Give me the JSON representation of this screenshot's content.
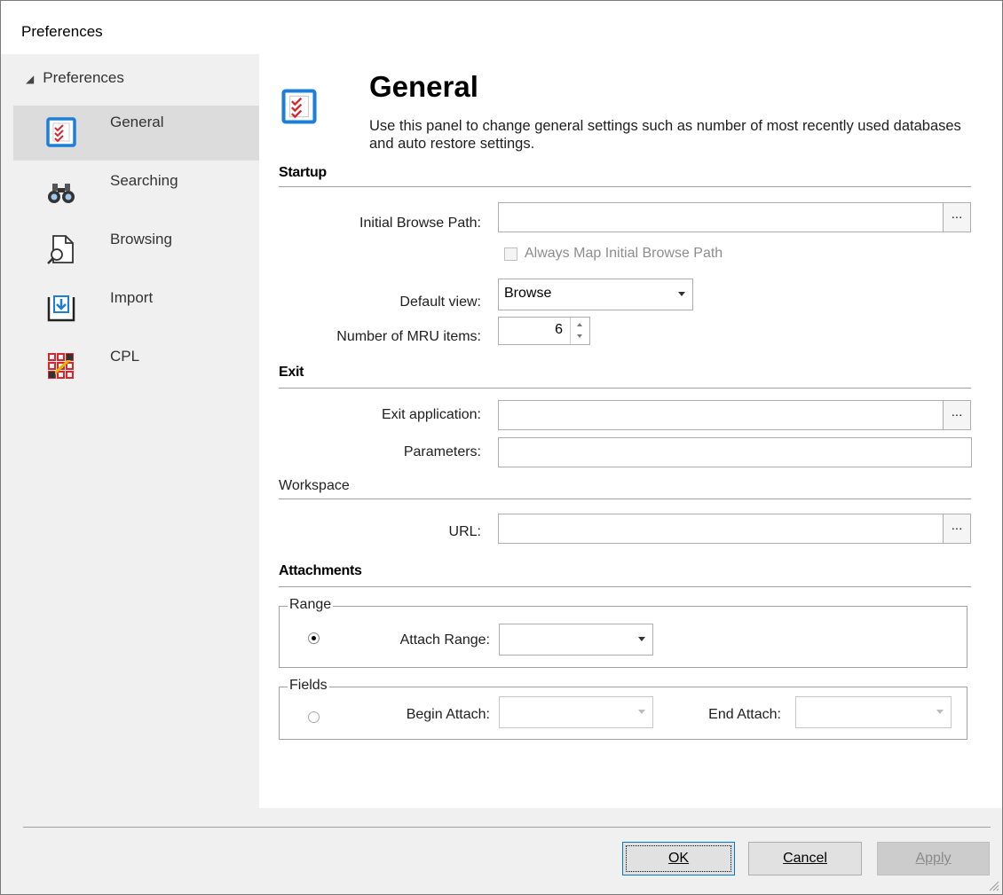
{
  "window": {
    "title": "Preferences"
  },
  "nav": {
    "root_label": "Preferences",
    "items": [
      {
        "label": "General",
        "icon": "checklist-icon",
        "selected": true
      },
      {
        "label": "Searching",
        "icon": "binoculars-icon",
        "selected": false
      },
      {
        "label": "Browsing",
        "icon": "document-search-icon",
        "selected": false
      },
      {
        "label": "Import",
        "icon": "import-tray-icon",
        "selected": false
      },
      {
        "label": "CPL",
        "icon": "grid-pencil-icon",
        "selected": false
      }
    ]
  },
  "page": {
    "title": "General",
    "description": "Use this panel to change general settings such as number of most recently used databases and auto restore settings."
  },
  "startup": {
    "heading": "Startup",
    "initial_browse_path_label": "Initial Browse Path:",
    "initial_browse_path_value": "",
    "browse_button": "...",
    "always_map_label": "Always Map Initial Browse Path",
    "always_map_checked": false,
    "default_view_label": "Default view:",
    "default_view_value": "Browse",
    "mru_label": "Number of MRU items:",
    "mru_value": "6"
  },
  "exit": {
    "heading": "Exit",
    "exit_application_label": "Exit application:",
    "exit_application_value": "",
    "browse_button": "...",
    "parameters_label": "Parameters:",
    "parameters_value": ""
  },
  "workspace": {
    "heading": "Workspace",
    "url_label": "URL:",
    "url_value": "",
    "browse_button": "..."
  },
  "attachments": {
    "heading": "Attachments",
    "range_group": "Range",
    "attach_range_label": "Attach Range:",
    "attach_range_value": "",
    "range_selected": true,
    "fields_group": "Fields",
    "begin_attach_label": "Begin Attach:",
    "begin_attach_value": "",
    "end_attach_label": "End Attach:",
    "end_attach_value": "",
    "fields_selected": false
  },
  "buttons": {
    "ok": "OK",
    "cancel": "Cancel",
    "apply": "Apply"
  },
  "colors": {
    "accent": "#0078d7",
    "icon_blue": "#1c7ed6",
    "icon_red": "#d8262f"
  }
}
